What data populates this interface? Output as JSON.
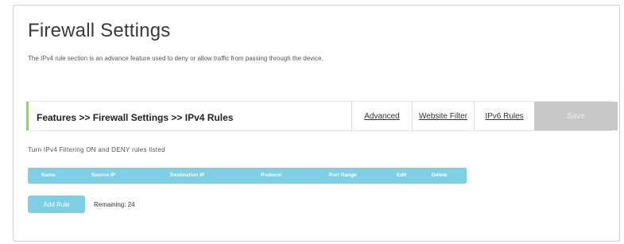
{
  "page": {
    "title": "Firewall Settings",
    "description": "The IPv4 rule section is an advance feature used to deny or allow traffic from passing through the device."
  },
  "nav": {
    "breadcrumb": "Features >> Firewall Settings >> IPv4 Rules",
    "links": [
      "Advanced",
      "Website Filter",
      "IPv6 Rules"
    ],
    "save_label": "Save"
  },
  "filter_note": "Turn IPv4 Filtering ON and DENY rules listed",
  "table": {
    "headers": [
      "Name",
      "Source IP",
      "Destination IP",
      "Protocol",
      "Port Range",
      "Edit",
      "Delete"
    ]
  },
  "add_rule_label": "Add Rule",
  "remaining_label": "Remaining: 24",
  "colors": {
    "accent_green": "#8fd35a",
    "table_header": "#7ecfe3",
    "save_disabled": "#c8c8c8"
  }
}
